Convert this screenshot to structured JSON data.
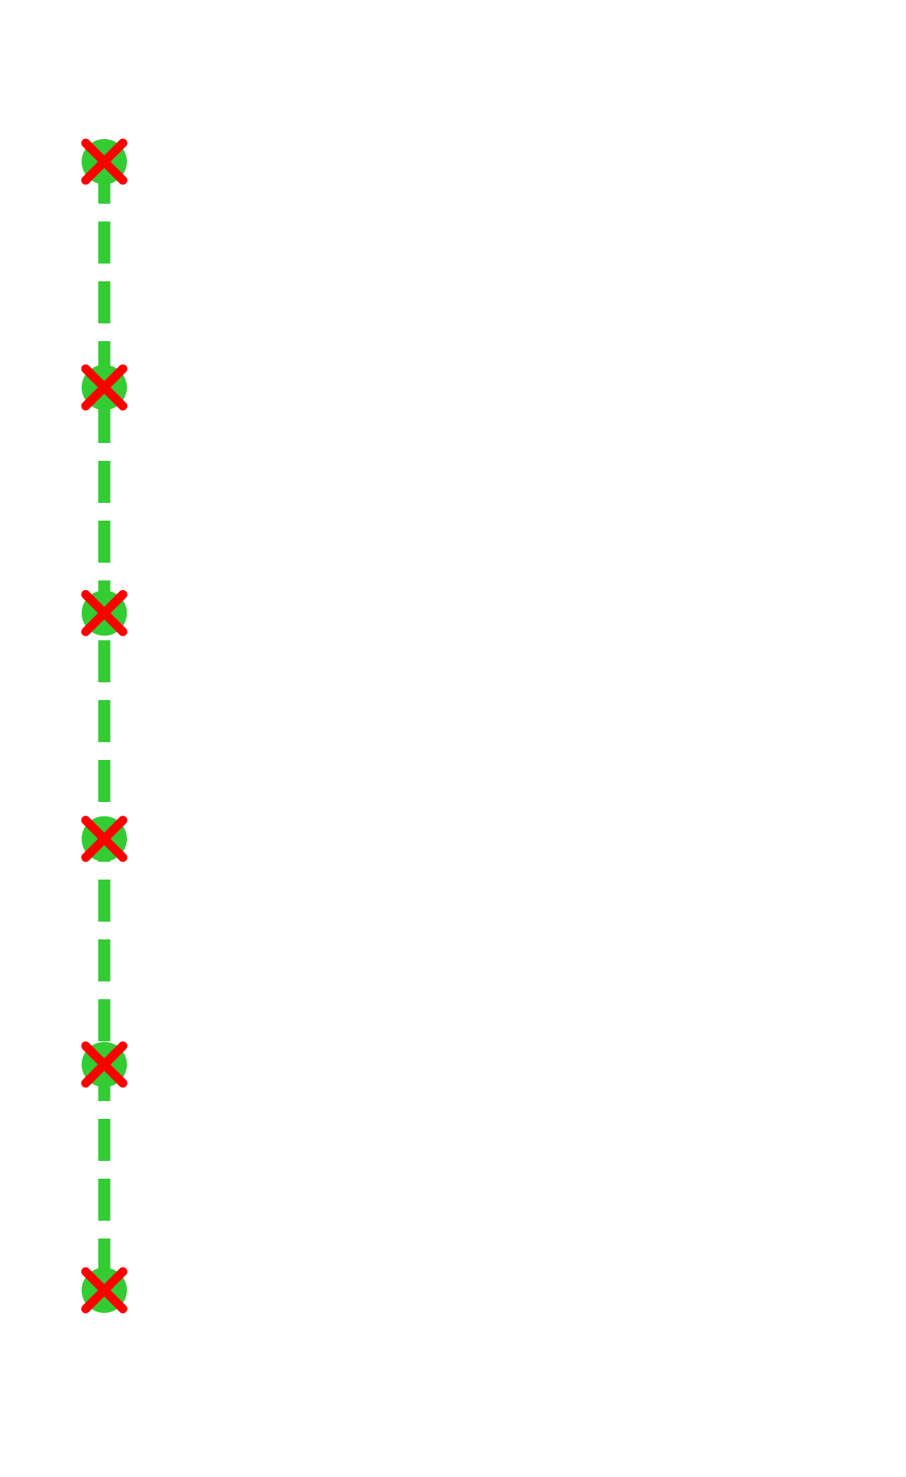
{
  "chart_data": {
    "type": "line",
    "title": "",
    "xlabel": "",
    "ylabel": "",
    "grid": false,
    "axes_visible": false,
    "xlim": [
      0,
      10
    ],
    "ylim": [
      0,
      6
    ],
    "series": [
      {
        "x": [
          1,
          1,
          1,
          1,
          1,
          1
        ],
        "y": [
          6,
          5,
          4,
          3,
          2,
          1
        ],
        "line_style": "dashed",
        "line_color": "#33cc33",
        "marker": "circle",
        "marker_color": "#33cc33",
        "overlay_marker": "x",
        "overlay_marker_color": "#ff0000"
      }
    ]
  }
}
